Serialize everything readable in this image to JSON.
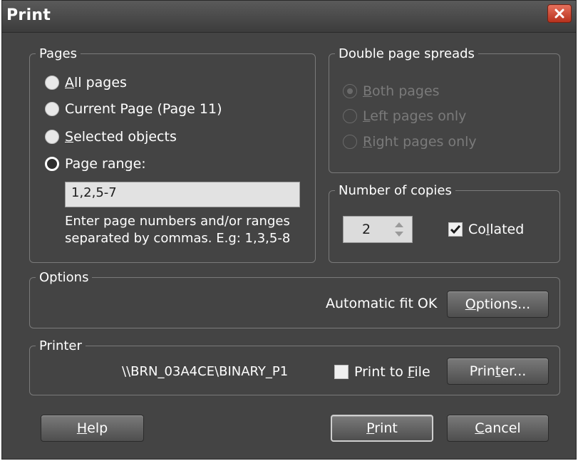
{
  "window": {
    "title": "Print"
  },
  "pages": {
    "legend": "Pages",
    "options": [
      {
        "pre": "",
        "key": "A",
        "post": "ll pages",
        "selected": false
      },
      {
        "pre": "Current Page (Page 11)",
        "key": "",
        "post": "",
        "selected": false
      },
      {
        "pre": "",
        "key": "S",
        "post": "elected objects",
        "selected": false
      },
      {
        "pre": "Page ran",
        "key": "g",
        "post": "e:",
        "selected": true
      }
    ],
    "range_value": "1,2,5-7",
    "hint_line1": "Enter page numbers and/or ranges",
    "hint_line2": "separated by commas. E.g: 1,3,5-8"
  },
  "spreads": {
    "legend": "Double page spreads",
    "options": [
      {
        "key": "B",
        "post": "oth pages",
        "selected": true
      },
      {
        "key": "L",
        "post": "eft pages only",
        "selected": false
      },
      {
        "key": "R",
        "post": "ight pages only",
        "selected": false
      }
    ]
  },
  "copies": {
    "legend": "Number of copies",
    "value": "2",
    "collated_pre": "Co",
    "collated_key": "l",
    "collated_post": "lated",
    "collated_checked": true
  },
  "options_group": {
    "legend": "Options",
    "status": "Automatic fit OK",
    "button_key": "O",
    "button_post": "ptions..."
  },
  "printer_group": {
    "legend": "Printer",
    "name": "\\\\BRN_03A4CE\\BINARY_P1",
    "print_to_file_pre": "Print to ",
    "print_to_file_key": "F",
    "print_to_file_post": "ile",
    "print_to_file_checked": false,
    "button_pre": "Prin",
    "button_key": "t",
    "button_post": "er..."
  },
  "footer": {
    "help_key": "H",
    "help_post": "elp",
    "print_key": "P",
    "print_post": "rint",
    "cancel_key": "C",
    "cancel_post": "ancel"
  },
  "colors": {
    "dialog_bg": "#444444",
    "close_button": "#c9432c",
    "disabled_text": "#7a7a7a"
  }
}
